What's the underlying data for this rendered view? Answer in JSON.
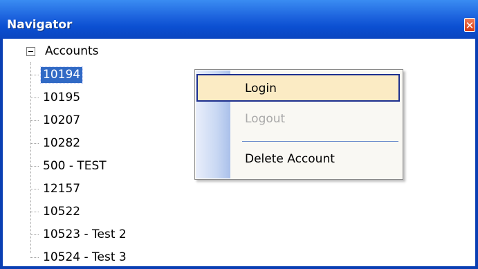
{
  "window": {
    "title": "Navigator",
    "close_glyph": "✕"
  },
  "tree": {
    "root_label": "Accounts",
    "items": [
      {
        "label": "10194",
        "selected": true
      },
      {
        "label": "10195"
      },
      {
        "label": "10207"
      },
      {
        "label": "10282"
      },
      {
        "label": "500 - TEST"
      },
      {
        "label": "12157"
      },
      {
        "label": "10522"
      },
      {
        "label": "10523 - Test 2"
      },
      {
        "label": "10524 - Test 3"
      }
    ]
  },
  "context_menu": {
    "items": [
      {
        "label": "Login",
        "state": "hover"
      },
      {
        "label": "Logout",
        "state": "disabled"
      },
      {
        "label": "Delete Account",
        "state": "normal"
      }
    ]
  },
  "colors": {
    "titlebar": "#0a4fd1",
    "selection": "#316ac5",
    "menu_hover": "#fbebc4"
  }
}
